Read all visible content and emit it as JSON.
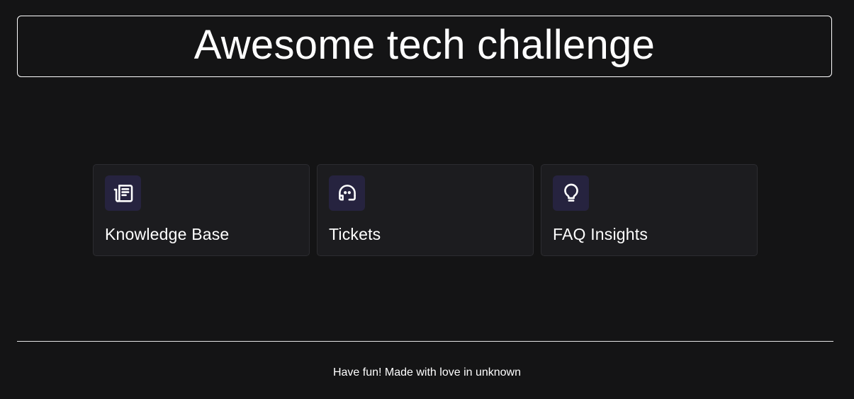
{
  "header": {
    "title": "Awesome tech challenge"
  },
  "cards": [
    {
      "label": "Knowledge Base",
      "icon": "newspaper-icon"
    },
    {
      "label": "Tickets",
      "icon": "headset-icon"
    },
    {
      "label": "FAQ Insights",
      "icon": "lightbulb-icon"
    }
  ],
  "footer": {
    "text": "Have fun! Made with love in unknown"
  },
  "colors": {
    "background": "#141415",
    "card_background": "#1c1c1f",
    "icon_background": "#26233f",
    "text": "#ffffff"
  }
}
